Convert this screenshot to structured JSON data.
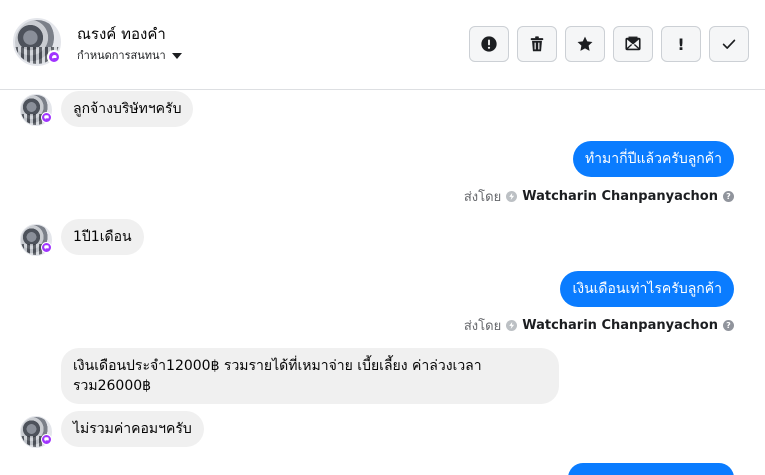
{
  "header": {
    "contact_name": "ณรงค์ ทองคำ",
    "assign_label": "กำหนดการสนทนา",
    "toolbar": [
      {
        "name": "spam-button",
        "icon": "alert-circle-icon"
      },
      {
        "name": "delete-button",
        "icon": "trash-icon"
      },
      {
        "name": "star-button",
        "icon": "star-icon"
      },
      {
        "name": "mark-unread-button",
        "icon": "envelope-icon"
      },
      {
        "name": "follow-up-button",
        "icon": "exclamation-icon"
      },
      {
        "name": "mark-done-button",
        "icon": "checkmark-icon"
      }
    ],
    "toolbar_glyphs": {
      "follow_up": "!"
    }
  },
  "messages": [
    {
      "id": "m1",
      "direction": "incoming",
      "text": "ลูกจ้างบริษัทฯครับ"
    },
    {
      "id": "m2",
      "direction": "outgoing",
      "text": "ทำมากี่ปีแล้วครับลูกค้า"
    },
    {
      "id": "m3",
      "direction": "incoming",
      "text": "1ปี1เดือน"
    },
    {
      "id": "m4",
      "direction": "outgoing",
      "text": "เงินเดือนเท่าไรครับลูกค้า"
    },
    {
      "id": "m5",
      "direction": "incoming",
      "text": "เงินเดือนประจำ12000฿ รวมรายได้ที่เหมาจ่าย เบี้ยเลี้ยง ค่าล่วงเวลา รวม26000฿"
    },
    {
      "id": "m6",
      "direction": "incoming",
      "text": "ไม่รวมค่าคอมฯครับ"
    }
  ],
  "sent_by": {
    "prefix": "ส่งโดย",
    "agent": "Watcharin Chanpanyachon",
    "help_glyph": "?"
  },
  "colors": {
    "outgoing_bubble": "#0a7cff",
    "incoming_bubble": "#f0f0f0",
    "messenger_badge": "#a033ff"
  }
}
